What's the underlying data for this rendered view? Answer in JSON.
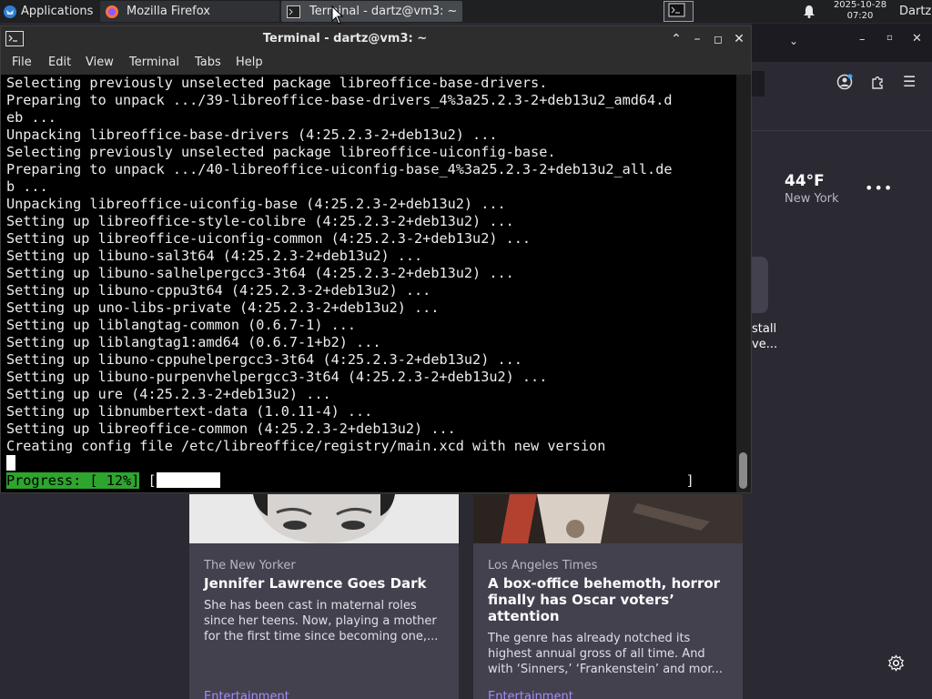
{
  "panel": {
    "applications_label": "Applications",
    "tasks": [
      {
        "label": "Mozilla Firefox"
      },
      {
        "label": "Terminal - dartz@vm3: ~"
      }
    ],
    "clock_date": "2025-10-28",
    "clock_time": "07:20",
    "user": "Dartz"
  },
  "terminal": {
    "title": "Terminal - dartz@vm3: ~",
    "menu": [
      "File",
      "Edit",
      "View",
      "Terminal",
      "Tabs",
      "Help"
    ],
    "lines": [
      "Selecting previously unselected package libreoffice-base-drivers.",
      "Preparing to unpack .../39-libreoffice-base-drivers_4%3a25.2.3-2+deb13u2_amd64.d",
      "eb ...",
      "Unpacking libreoffice-base-drivers (4:25.2.3-2+deb13u2) ...",
      "Selecting previously unselected package libreoffice-uiconfig-base.",
      "Preparing to unpack .../40-libreoffice-uiconfig-base_4%3a25.2.3-2+deb13u2_all.de",
      "b ...",
      "Unpacking libreoffice-uiconfig-base (4:25.2.3-2+deb13u2) ...",
      "Setting up libreoffice-style-colibre (4:25.2.3-2+deb13u2) ...",
      "Setting up libreoffice-uiconfig-common (4:25.2.3-2+deb13u2) ...",
      "Setting up libuno-sal3t64 (4:25.2.3-2+deb13u2) ...",
      "Setting up libuno-salhelpergcc3-3t64 (4:25.2.3-2+deb13u2) ...",
      "Setting up libuno-cppu3t64 (4:25.2.3-2+deb13u2) ...",
      "Setting up uno-libs-private (4:25.2.3-2+deb13u2) ...",
      "Setting up liblangtag-common (0.6.7-1) ...",
      "Setting up liblangtag1:amd64 (0.6.7-1+b2) ...",
      "Setting up libuno-cppuhelpergcc3-3t64 (4:25.2.3-2+deb13u2) ...",
      "Setting up libuno-purpenvhelpergcc3-3t64 (4:25.2.3-2+deb13u2) ...",
      "Setting up ure (4:25.2.3-2+deb13u2) ...",
      "Setting up libnumbertext-data (1.0.11-4) ...",
      "Setting up libreoffice-common (4:25.2.3-2+deb13u2) ...",
      "Creating config file /etc/libreoffice/registry/main.xcd with new version"
    ],
    "progress_label": "Progress: [ 12%]",
    "progress_fraction": 0.12,
    "progress_open": "[",
    "progress_close": "]"
  },
  "firefox": {
    "weather_temp": "44°F",
    "weather_location": "New York",
    "shortcut_label_1": "stall",
    "shortcut_label_2": "ve...",
    "cards": [
      {
        "source": "The New Yorker",
        "title": "Jennifer Lawrence Goes Dark",
        "description": "She has been cast in maternal roles since her teens. Now, playing a mother for the first time since becoming one,...",
        "category": "Entertainment"
      },
      {
        "source": "Los Angeles Times",
        "title": "A box-office behemoth, horror finally has Oscar voters’ attention",
        "description": "The genre has already notched its highest annual gross of all time. And with ‘Sinners,’ ‘Frankenstein’ and mor...",
        "category": "Entertainment"
      }
    ]
  }
}
